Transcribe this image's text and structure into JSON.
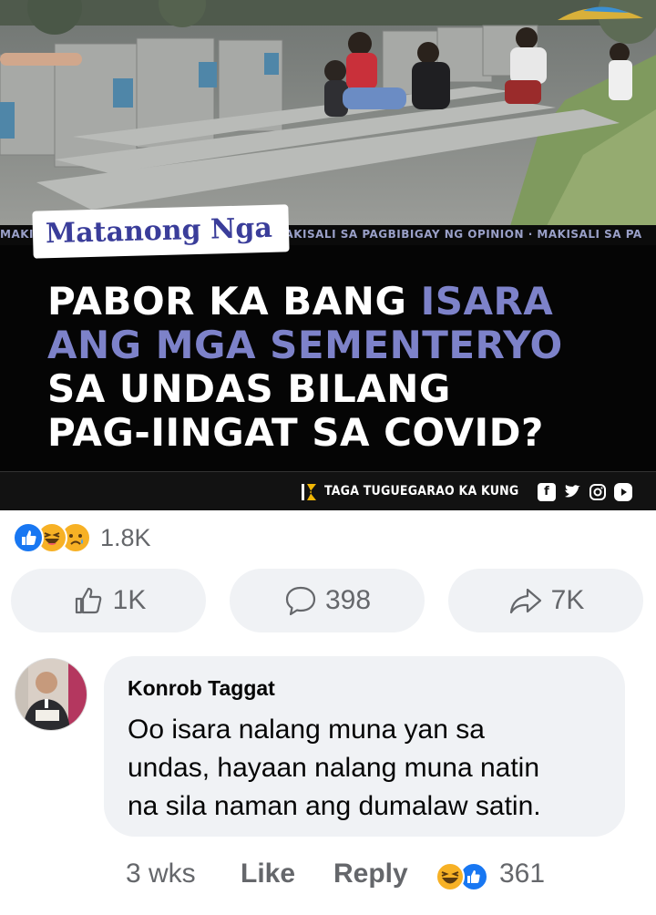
{
  "post_image": {
    "ticker_left": "MAKI",
    "ticker_right": "MAKISALI SA PAGBIBIGAY NG OPINION · MAKISALI SA PA",
    "brand_tag": "Matanong Nga",
    "headline_parts": [
      {
        "text": "PABOR KA BANG ",
        "highlight": false
      },
      {
        "text": "ISARA",
        "highlight": true
      },
      {
        "text": "ANG MGA SEMENTERYO",
        "highlight": true
      },
      {
        "text": "SA UNDAS BILANG",
        "highlight": false
      },
      {
        "text": "PAG-IINGAT SA COVID?",
        "highlight": false
      }
    ],
    "footer_text": "TAGA TUGUEGARAO KA KUNG",
    "social_icons": [
      "facebook-icon",
      "twitter-icon",
      "instagram-icon",
      "youtube-icon"
    ],
    "colors": {
      "highlight": "#7d82c9",
      "panel": "#050505",
      "brand": "#3a3d9a"
    }
  },
  "reactions": {
    "icons": [
      "like",
      "haha",
      "sad"
    ],
    "count": "1.8K"
  },
  "actions": {
    "like_count": "1K",
    "comment_count": "398",
    "share_count": "7K"
  },
  "comment": {
    "author": "Konrob Taggat",
    "text_lines": [
      "Oo isara nalang muna yan sa",
      "undas, hayaan nalang muna natin",
      "na sila naman ang dumalaw satin."
    ],
    "time": "3 wks",
    "like_label": "Like",
    "reply_label": "Reply",
    "reaction_count": "361"
  },
  "colors": {
    "accent": "#1877f2",
    "muted": "#65676b",
    "bubble": "#f0f2f5"
  }
}
